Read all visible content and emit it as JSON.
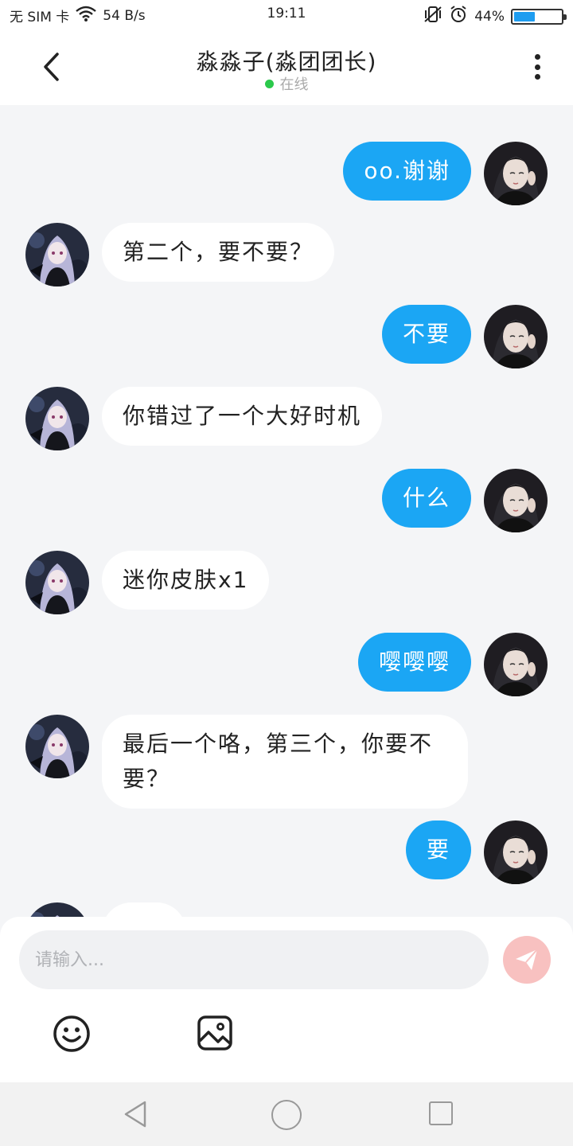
{
  "status_bar": {
    "sim": "无 SIM 卡",
    "speed": "54 B/s",
    "time": "19:11",
    "battery": "44%",
    "battery_level": 0.44
  },
  "header": {
    "title": "淼淼子(淼团团长)",
    "status": "在线"
  },
  "messages": [
    {
      "side": "right",
      "text": "oo.谢谢"
    },
    {
      "side": "left",
      "text": "第二个，要不要？"
    },
    {
      "side": "right",
      "text": "不要"
    },
    {
      "side": "left",
      "text": "你错过了一个大好时机"
    },
    {
      "side": "right",
      "text": "什么"
    },
    {
      "side": "left",
      "text": "迷你皮肤x1"
    },
    {
      "side": "right",
      "text": "嘤嘤嘤"
    },
    {
      "side": "left",
      "text": "最后一个咯，第三个，你要不要？"
    },
    {
      "side": "right",
      "text": "要"
    }
  ],
  "composer": {
    "placeholder": "请输入..."
  },
  "colors": {
    "accent": "#1ba6f4",
    "send_button": "#f8c1c0",
    "online": "#2bc94b"
  },
  "icons": {
    "back": "chevron-left-icon",
    "more": "more-vertical-icon",
    "send": "paper-plane-icon",
    "emoji": "smiley-icon",
    "image": "image-icon"
  }
}
